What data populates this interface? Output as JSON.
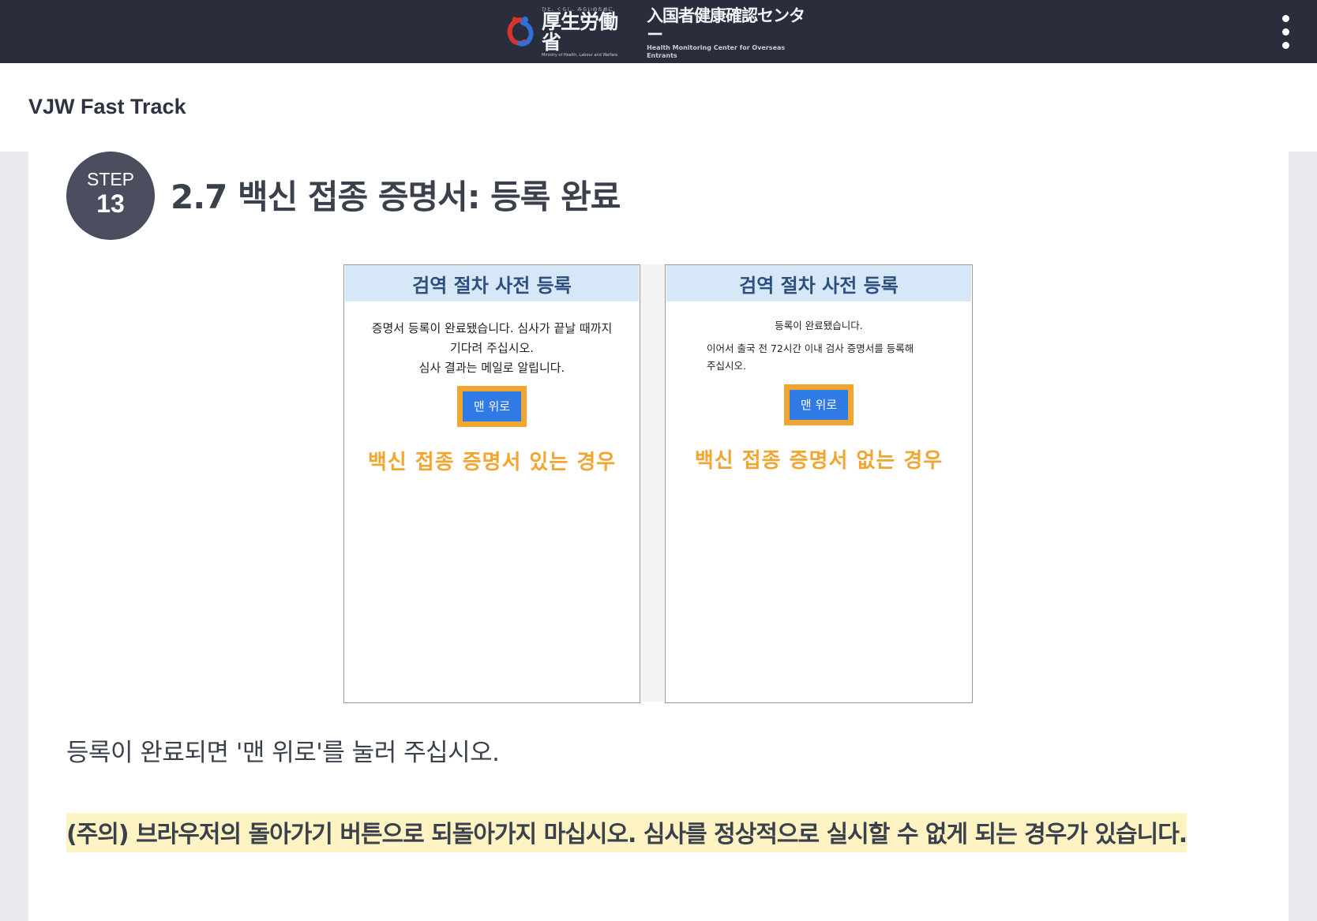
{
  "header": {
    "ministry_tagline": "ひと、くらし、みらいのために",
    "ministry_name": "厚生労働省",
    "ministry_sub": "Ministry of Health, Labour and Welfare",
    "center_name": "入国者健康確認センター",
    "center_sub": "Health Monitoring Center for Overseas Entrants",
    "menu_icon": "kebab-menu-icon"
  },
  "app": {
    "title": "VJW Fast Track"
  },
  "step": {
    "label": "STEP",
    "number": "13",
    "title": "2.7 백신 접종 증명서: 등록 완료"
  },
  "figure": {
    "left": {
      "header": "검역 절차 사전 등록",
      "message_lines": [
        "증명서 등록이 완료됐습니다. 심사가 끝날 때까지",
        "기다려 주십시오.",
        "심사 결과는 메일로 알립니다."
      ],
      "button_label": "맨 위로",
      "case_label": "백신 접종 증명서 있는 경우"
    },
    "right": {
      "header": "검역 절차 사전 등록",
      "message_lines": [
        "등록이 완료됐습니다.",
        "이어서 출국 전 72시간 이내 검사 증명서를 등록해",
        "주십시오."
      ],
      "button_label": "맨 위로",
      "case_label": "백신 접종 증명서 없는 경우"
    },
    "highlight_color": "#f0a630",
    "header_bg": "#d6e7f8",
    "button_color": "#2f7ae5"
  },
  "instruction": "등록이 완료되면 '맨 위로'를 눌러 주십시오.",
  "warning": "(주의) 브라우저의 돌아가기 버튼으로 되돌아가지 마십시오. 심사를 정상적으로 실시할 수 없게 되는 경우가 있습니다."
}
